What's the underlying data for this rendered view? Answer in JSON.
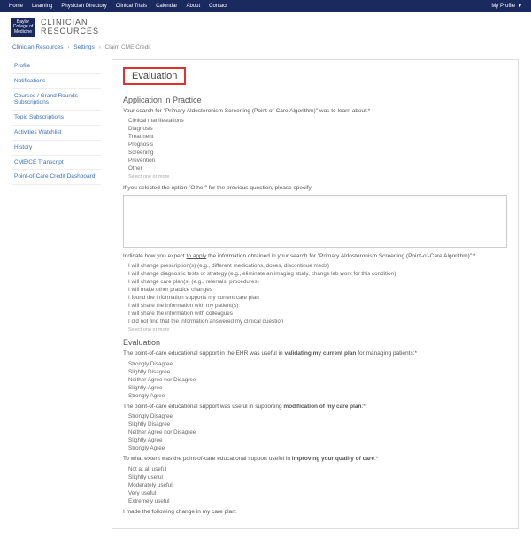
{
  "topnav": [
    "Home",
    "Learning",
    "Physician Directory",
    "Clinical Trials",
    "Calendar",
    "About",
    "Contact"
  ],
  "profile_label": "My Profile",
  "logo_lines": [
    "Baylor",
    "College of",
    "Medicine"
  ],
  "brand_l1": "CLINICIAN",
  "brand_l2": "RESOURCES",
  "breadcrumb": {
    "a": "Clinician Resources",
    "b": "Settings",
    "c": "Claim CME Credit"
  },
  "sidebar": [
    "Profile",
    "Notifications",
    "Courses / Grand Rounds Subscriptions",
    "Topic Subscriptions",
    "Activities Watchlist",
    "History",
    "CME/CE Transcript",
    "Point-of-Care Credit Dashboard"
  ],
  "title": "Evaluation",
  "section1": "Application in Practice",
  "q1": "Your search for \"Primary Aldosteronism Screening (Point-of-Care Algorithm)\" was to learn about:*",
  "q1_opts": [
    "Clinical manifestations",
    "Diagnosis",
    "Treatment",
    "Prognosis",
    "Screening",
    "Prevention",
    "Other"
  ],
  "select_hint": "Select one or more",
  "q2": "If you selected the option \"Other\" for the previous question, please specify:",
  "q3_a": "Indicate how you expect ",
  "q3_u": "to apply",
  "q3_b": " the information obtained in your search for \"Primary Aldosteronism Screening (Point-of-Care Algorithm)\":*",
  "q3_opts": [
    "I will change prescription(s) (e.g., different medications, doses, discontinue meds)",
    "I will change diagnostic tests or strategy (e.g., eliminate an imaging study, change lab work for this condition)",
    "I will change care plan(s) (e.g., referrals, procedures)",
    "I will make other practice changes",
    "I found the information supports my current care plan",
    "I will share the information with my patient(s)",
    "I will share the information with colleagues",
    "I did not find that the information answered my clinical question"
  ],
  "section2": "Evaluation",
  "q4_a": "The point-of-care educational support in the EHR was useful in ",
  "q4_b": "validating my current plan",
  "q4_c": " for managing patients:*",
  "q5_a": "The point-of-care educational support was useful in supporting ",
  "q5_b": "modification of my care plan",
  "q5_c": ":*",
  "likert": [
    "Strongly Disagree",
    "Slightly Disagree",
    "Neither Agree nor Disagree",
    "Slightly Agree",
    "Strongly Agree"
  ],
  "q6_a": "To what extent was the point-of-care educational support useful in ",
  "q6_b": "improving your quality of care",
  "q6_c": ":*",
  "q6_opts": [
    "Not at all useful",
    "Slightly useful",
    "Moderately useful",
    "Very useful",
    "Extremely useful"
  ],
  "q7": "I made the following change in my care plan:"
}
